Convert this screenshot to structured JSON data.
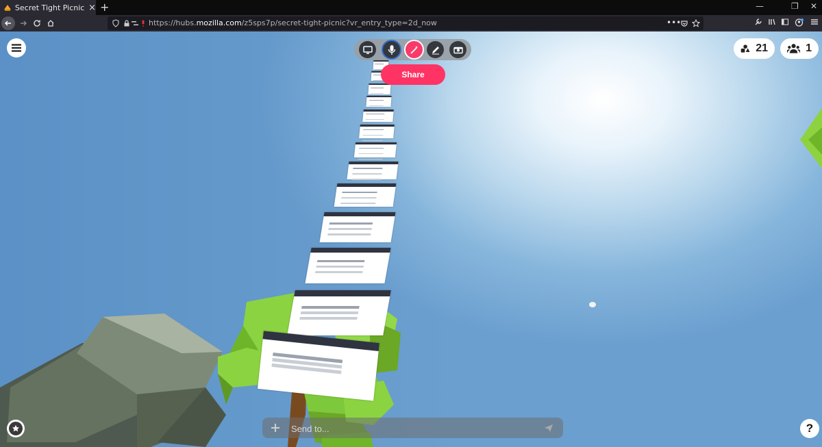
{
  "browser": {
    "tab_title": "Secret Tight Picnic | Hubs by M",
    "tab_close": "×",
    "new_tab": "+",
    "url_prefix": "https://hubs.",
    "url_domain": "mozilla.com",
    "url_path": "/z5sps7p/secret-tight-picnic?vr_entry_type=2d_now",
    "url_more": "•••"
  },
  "hud": {
    "share_label": "Share",
    "objects_count": "21",
    "people_count": "1",
    "chat_placeholder": "Send to...",
    "help_label": "?"
  },
  "colors": {
    "share": "#ff3464",
    "accent_blue": "#2f6fd0",
    "accent_pink": "#ff3464",
    "tree_green": "#7ec93b",
    "trunk": "#7a4a1f"
  }
}
